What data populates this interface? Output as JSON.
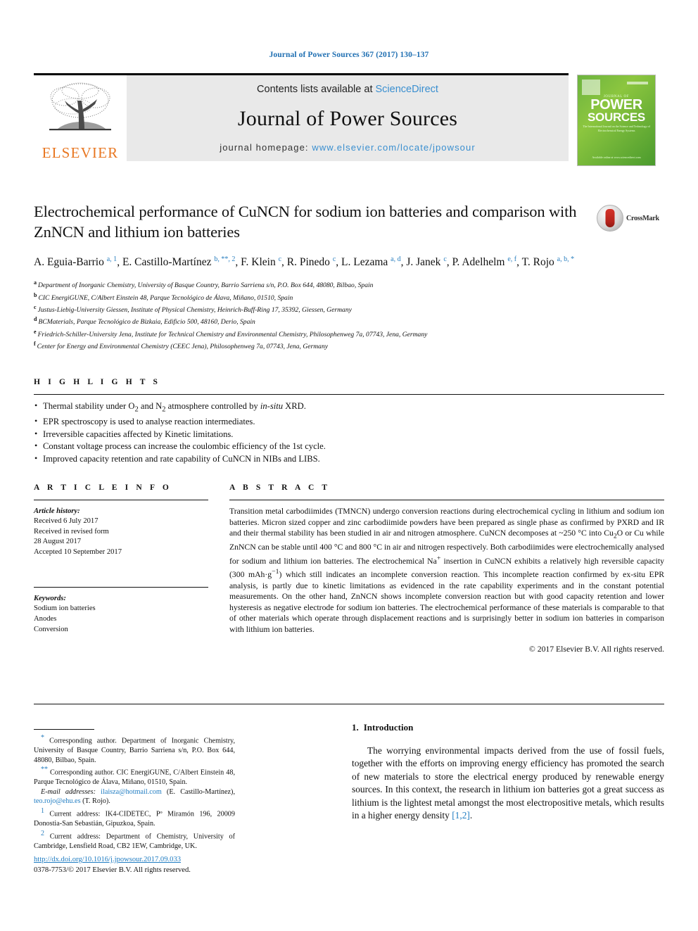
{
  "running_head": "Journal of Power Sources 367 (2017) 130–137",
  "masthead": {
    "contents_prefix": "Contents lists available at ",
    "sciencedirect": "ScienceDirect",
    "journal_name": "Journal of Power Sources",
    "homepage_prefix": "journal homepage: ",
    "homepage_url": "www.elsevier.com/locate/jpowsour",
    "publisher": "ELSEVIER",
    "cover": {
      "elsevier": "ELSEVIER",
      "eyebrow": "JOURNAL OF",
      "power": "POWER",
      "sources": "SOURCES",
      "subtitle": "The International Journal on the Science and Technology of Electrochemical Energy Systems",
      "footer": "Available online at\nwww.sciencedirect.com"
    }
  },
  "crossmark": {
    "label": "CrossMark"
  },
  "article": {
    "title": "Electrochemical performance of CuNCN for sodium ion batteries and comparison with ZnNCN and lithium ion batteries",
    "authors": [
      {
        "name": "A. Eguia-Barrio",
        "marks": "a, 1"
      },
      {
        "name": "E. Castillo-Martínez",
        "marks": "b, **, 2"
      },
      {
        "name": "F. Klein",
        "marks": "c"
      },
      {
        "name": "R. Pinedo",
        "marks": "c"
      },
      {
        "name": "L. Lezama",
        "marks": "a, d"
      },
      {
        "name": "J. Janek",
        "marks": "c"
      },
      {
        "name": "P. Adelhelm",
        "marks": "e, f"
      },
      {
        "name": "T. Rojo",
        "marks": "a, b, *"
      }
    ],
    "affiliations": [
      {
        "key": "a",
        "text": "Department of Inorganic Chemistry, University of Basque Country, Barrio Sarriena s/n, P.O. Box 644, 48080, Bilbao, Spain"
      },
      {
        "key": "b",
        "text": "CIC EnergiGUNE, C/Albert Einstein 48, Parque Tecnológico de Álava, Miñano, 01510, Spain"
      },
      {
        "key": "c",
        "text": "Justus-Liebig-University Giessen, Institute of Physical Chemistry, Heinrich-Buff-Ring 17, 35392, Giessen, Germany"
      },
      {
        "key": "d",
        "text": "BCMaterials, Parque Tecnológico de Bizkaia, Edificio 500, 48160, Derio, Spain"
      },
      {
        "key": "e",
        "text": "Friedrich-Schiller-University Jena, Institute for Technical Chemistry and Environmental Chemistry, Philosophenweg 7a, 07743, Jena, Germany"
      },
      {
        "key": "f",
        "text": "Center for Energy and Environmental Chemistry (CEEC Jena), Philosophenweg 7a, 07743, Jena, Germany"
      }
    ]
  },
  "highlights": {
    "heading": "H I G H L I G H T S",
    "items": [
      {
        "pre": "Thermal stability under O",
        "sub1": "2",
        "mid": " and N",
        "sub2": "2",
        "post": " atmosphere controlled by ",
        "em": "in-situ",
        "tail": " XRD."
      },
      {
        "pre": "EPR spectroscopy is used to analyse reaction intermediates.",
        "sub1": "",
        "mid": "",
        "sub2": "",
        "post": "",
        "em": "",
        "tail": ""
      },
      {
        "pre": "Irreversible capacities affected by Kinetic limitations.",
        "sub1": "",
        "mid": "",
        "sub2": "",
        "post": "",
        "em": "",
        "tail": ""
      },
      {
        "pre": "Constant voltage process can increase the coulombic efficiency of the 1st cycle.",
        "sub1": "",
        "mid": "",
        "sub2": "",
        "post": "",
        "em": "",
        "tail": ""
      },
      {
        "pre": "Improved capacity retention and rate capability of CuNCN in NIBs and LIBS.",
        "sub1": "",
        "mid": "",
        "sub2": "",
        "post": "",
        "em": "",
        "tail": ""
      }
    ]
  },
  "article_info": {
    "heading": "A R T I C L E   I N F O",
    "history_label": "Article history:",
    "history": [
      "Received 6 July 2017",
      "Received in revised form",
      "28 August 2017",
      "Accepted 10 September 2017"
    ],
    "keywords_label": "Keywords:",
    "keywords": [
      "Sodium ion batteries",
      "Anodes",
      "Conversion"
    ]
  },
  "abstract": {
    "heading": "A B S T R A C T",
    "p1": "Transition metal carbodiimides (TMNCN) undergo conversion reactions during electrochemical cycling in lithium and sodium ion batteries. Micron sized copper and zinc carbodiimide powders have been prepared as single phase as confirmed by PXRD and IR and their thermal stability has been studied in air and nitrogen atmosphere. CuNCN decomposes at ~250 °C into Cu",
    "p1b": "O or Cu while ZnNCN can be stable until 400 °C and 800 °C in air and nitrogen respectively. Both carbodiimides were electrochemically analysed for sodium and lithium ion batteries. The electrochemical Na",
    "sup_plus": "+",
    "p1c": " insertion in CuNCN exhibits a relatively high reversible capacity (300 mAh·g",
    "sup_minus1": "−1",
    "p1d": ") which still indicates an incomplete conversion reaction. This incomplete reaction confirmed by ex-situ EPR analysis, is partly due to kinetic limitations as evidenced in the rate capability experiments and in the constant potential measurements. On the other hand, ZnNCN shows incomplete conversion reaction but with good capacity retention and lower hysteresis as negative electrode for sodium ion batteries. The electrochemical performance of these materials is comparable to that of other materials which operate through displacement reactions and is surprisingly better in sodium ion batteries in comparison with lithium ion batteries.",
    "cu_sub": "2",
    "copyright": "© 2017 Elsevier B.V. All rights reserved."
  },
  "footnotes": {
    "star_mark": "*",
    "star_text": "Corresponding author. Department of Inorganic Chemistry, University of Basque Country, Barrio Sarriena s/n, P.O. Box 644, 48080, Bilbao, Spain.",
    "dstar_mark": "**",
    "dstar_text": "Corresponding author. CIC EnergiGUNE, C/Albert Einstein 48, Parque Tecnológico de Álava, Miñano, 01510, Spain.",
    "email_label": "E-mail addresses:",
    "email1": "ilaisza@hotmail.com",
    "email1_owner": "(E. Castillo-Martínez),",
    "email2": "teo.rojo@ehu.es",
    "email2_owner": "(T. Rojo).",
    "note1_mark": "1",
    "note1_text": "Current address: IK4-CIDETEC, Pº Miramón 196, 20009 Donostia-San Sebastián, Gipuzkoa, Spain.",
    "note2_mark": "2",
    "note2_text": "Current address: Department of Chemistry, University of Cambridge, Lensfield Road, CB2 1EW, Cambridge, UK."
  },
  "doi": {
    "url": "http://dx.doi.org/10.1016/j.jpowsour.2017.09.033",
    "issn": "0378-7753/© 2017 Elsevier B.V. All rights reserved."
  },
  "introduction": {
    "number": "1.",
    "heading": "Introduction",
    "paragraph": "The worrying environmental impacts derived from the use of fossil fuels, together with the efforts on improving energy efficiency has promoted the search of new materials to store the electrical energy produced by renewable energy sources. In this context, the research in lithium ion batteries got a great success as lithium is the lightest metal amongst the most electropositive metals, which results in a higher energy density ",
    "citation": "[1,2]",
    "paragraph_end": "."
  },
  "colors": {
    "link": "#1f7cc2",
    "elsevier_orange": "#E87722",
    "masthead_grey": "#e9e9e9",
    "cover_green": "#6cb33f"
  }
}
